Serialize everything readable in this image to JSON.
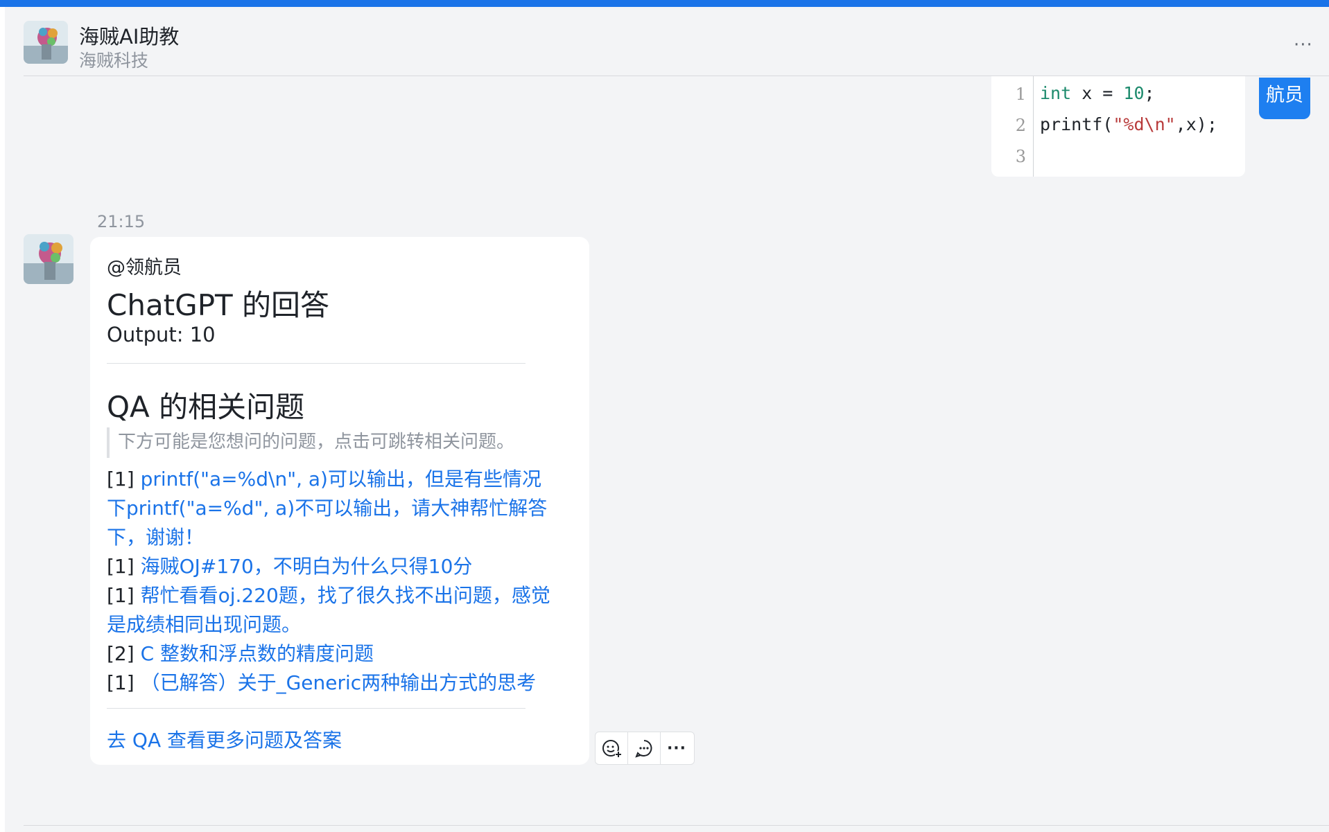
{
  "colors": {
    "accent": "#1a73e8",
    "sender_tag": "#1e7ff0",
    "link": "#1a73e8"
  },
  "header": {
    "title": "海贼AI助教",
    "subtitle": "海贼科技",
    "more_icon": "more-horizontal-icon",
    "more_label": "···"
  },
  "user_message": {
    "sender_tag": "航员",
    "code": {
      "line_numbers": [
        "1",
        "2",
        "3"
      ],
      "lines": [
        "int x = 10;",
        "printf(\"%d\\n\",x);",
        ""
      ]
    }
  },
  "bot_message": {
    "timestamp": "21:15",
    "mention": "@领航员",
    "answer_heading": "ChatGPT 的回答",
    "output_text": "Output: 10",
    "qa_heading": "QA 的相关问题",
    "qa_hint": "下方可能是您想问的问题，点击可跳转相关问题。",
    "qa_items": [
      {
        "count": "[1]",
        "title": "printf(\"a=%d\\n\", a)可以输出，但是有些情况下printf(\"a=%d\", a)不可以输出，请大神帮忙解答下，谢谢！"
      },
      {
        "count": "[1]",
        "title": "海贼OJ#170，不明白为什么只得10分"
      },
      {
        "count": "[1]",
        "title": "帮忙看看oj.220题，找了很久找不出问题，感觉是成绩相同出现问题。"
      },
      {
        "count": "[2]",
        "title": "C 整数和浮点数的精度问题"
      },
      {
        "count": "[1]",
        "title": "（已解答）关于_Generic两种输出方式的思考"
      }
    ],
    "goto_qa": "去 QA 查看更多问题及答案"
  },
  "actions": {
    "emoji_icon": "add-reaction-icon",
    "reply_icon": "reply-comment-icon",
    "more_icon": "more-horizontal-icon",
    "more_label": "···"
  }
}
